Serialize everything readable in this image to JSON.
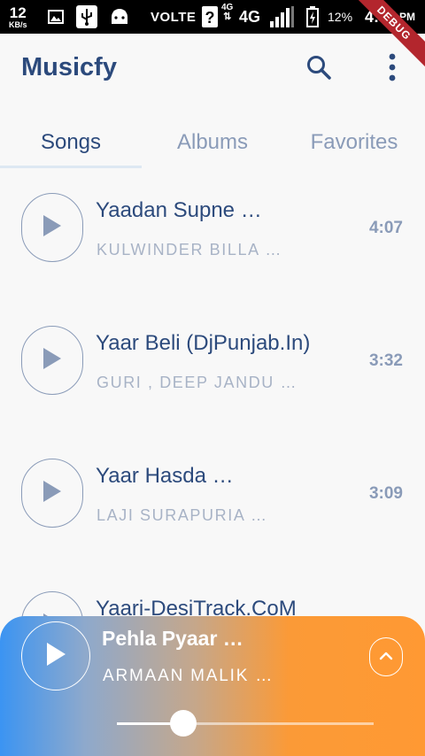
{
  "status_bar": {
    "speed": "12",
    "speed_unit": "KB/s",
    "volte": "VOLTE",
    "network": "4G",
    "network_small": "4G",
    "battery": "12%",
    "time": "4:52",
    "ampm": "PM",
    "debug_banner": "DEBUG"
  },
  "app_bar": {
    "title": "Musicfy",
    "icons": [
      "search-icon",
      "more-vertical-icon"
    ]
  },
  "tabs": [
    {
      "label": "Songs",
      "active": true
    },
    {
      "label": "Albums",
      "active": false
    },
    {
      "label": "Favorites",
      "active": false
    }
  ],
  "songs": [
    {
      "title": "Yaadan Supne …",
      "artist": "KULWINDER BILLA …",
      "duration": "4:07"
    },
    {
      "title": "Yaar Beli (DjPunjab.In)",
      "artist": "GURI , DEEP JANDU …",
      "duration": "3:32"
    },
    {
      "title": "Yaar Hasda …",
      "artist": "LAJI SURAPURIA …",
      "duration": "3:09"
    },
    {
      "title": "Yaari-DesiTrack.CoM",
      "artist": "",
      "duration": ""
    }
  ],
  "player": {
    "title": "Pehla Pyaar …",
    "artist": "ARMAAN MALIK …",
    "progress": 0.26,
    "gradient_start": "#3b94f2",
    "gradient_end": "#ff9933"
  },
  "colors": {
    "primary": "#2c4a7c",
    "muted": "#8a9bb8",
    "background": "#f8f8f8"
  }
}
